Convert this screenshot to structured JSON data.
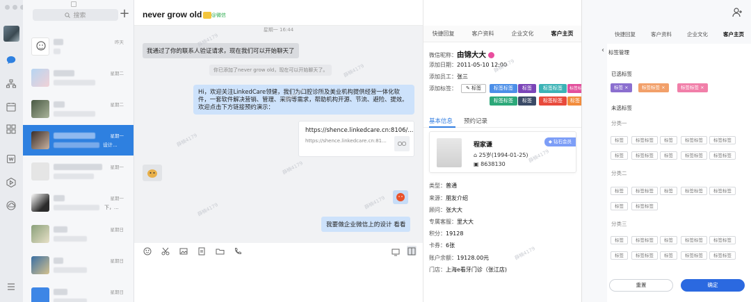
{
  "sidebar": {
    "icons": [
      "chat-icon",
      "contacts-icon",
      "calendar-icon",
      "apps-icon",
      "docs-icon",
      "video-icon",
      "cloud-icon",
      "menu-icon"
    ]
  },
  "chat_list": {
    "search_placeholder": "搜索",
    "items": [
      {
        "time": "昨天",
        "extra": ""
      },
      {
        "time": "星期二",
        "extra": ""
      },
      {
        "time": "星期二",
        "extra": ""
      },
      {
        "time": "星期一",
        "extra": "设计..."
      },
      {
        "time": "星期一",
        "extra": ""
      },
      {
        "time": "星期一",
        "extra": "下，..."
      },
      {
        "time": "星期日",
        "extra": ""
      },
      {
        "time": "星期日",
        "extra": ""
      },
      {
        "time": "星期日",
        "extra": ""
      }
    ]
  },
  "chat": {
    "title": "never grow old",
    "wechat_tag": "@微信",
    "time_divider": "星期一 16:44",
    "msg_verified": "我通过了你的联系人验证请求，现在我们可以开始聊天了",
    "sys_added": "你已添加了never grow old，现在可以开始聊天了。",
    "msg_welcome": "Hi，欢迎关注LinkedCare领健，我们为口腔诊所及美业机构提供经营一体化软件，一套软件解决营销、管理、采购等需求，帮助机构开源、节流、避险、提效。欢迎点击下方链接预约演示：",
    "link_title": "https://shence.linkedcare.cn:8106/...",
    "link_sub": "https://shence.linkedcare.cn:81...",
    "msg_design": "我要做企业微信上的设计  看看",
    "watermark": "薛楠4179"
  },
  "customer": {
    "tabs": [
      "快捷回复",
      "客户资料",
      "企业文化",
      "客户主页"
    ],
    "active_tab": "客户主页",
    "nickname_label": "微信昵称：",
    "nickname": "由锦大大",
    "added_date_label": "添加日期：",
    "added_date": "2011-05-10  12:00",
    "added_staff_label": "添加员工：",
    "added_staff": "张三",
    "tags_label": "添加标签：",
    "add_tag_btn": "标签",
    "tags": [
      {
        "text": "标签标签",
        "color": "#4c8fe8"
      },
      {
        "text": "标签",
        "color": "#7b45b8"
      },
      {
        "text": "标签标签",
        "color": "#3bb3b6"
      },
      {
        "text": "标签标签",
        "color": "#e24f9c"
      },
      {
        "text": "标签标签",
        "color": "#2ca879"
      },
      {
        "text": "标签",
        "color": "#3a4a66"
      },
      {
        "text": "标签标签",
        "color": "#e84a3c"
      },
      {
        "text": "标签",
        "color": "#f28c3c"
      }
    ],
    "subtabs": [
      "基本信息",
      "预约记录"
    ],
    "card": {
      "name": "程家谦",
      "age": "25岁(1994-01-25)",
      "id": "8638130",
      "vip": "钻石会员"
    },
    "info": [
      {
        "label": "类型：",
        "value": "普通"
      },
      {
        "label": "来源：",
        "value": "朋友介绍"
      },
      {
        "label": "顾问：",
        "value": "张大大"
      },
      {
        "label": "专属客服：",
        "value": "里大大"
      },
      {
        "label": "积分：",
        "value": "19128"
      },
      {
        "label": "卡券：",
        "value": "6张"
      },
      {
        "label": "账户余额：",
        "value": "19128.00元"
      },
      {
        "label": "门店：",
        "value": "上海e看牙门诊（张江店)"
      }
    ]
  },
  "tag_manager": {
    "tabs": [
      "快捷回复",
      "客户资料",
      "企业文化",
      "客户主页"
    ],
    "title": "标签管理",
    "selected_label": "已选标签",
    "selected": [
      {
        "text": "标签",
        "color": "#8b6fcf"
      },
      {
        "text": "标签标签",
        "color": "#f2a06a"
      },
      {
        "text": "标签标签",
        "color": "#f17fa9"
      }
    ],
    "unselected_label": "未选标签",
    "groups": [
      {
        "name": "分类一",
        "rows": [
          [
            "标签",
            "标签标签",
            "标签",
            "标签标签",
            "标签标签"
          ],
          [
            "标签",
            "标签标签",
            "标签",
            "标签标签",
            "标签标签"
          ]
        ]
      },
      {
        "name": "分类二",
        "rows": [
          [
            "标签",
            "标签标签",
            "标签",
            "标签标签",
            "标签标签"
          ],
          [
            "标签",
            "标签标签"
          ]
        ]
      },
      {
        "name": "分类三",
        "rows": [
          [
            "标签",
            "标签标签",
            "标签",
            "标签标签",
            "标签标签"
          ],
          [
            "标签",
            "标签标签",
            "标签",
            "标签标签",
            "标签标签"
          ]
        ]
      }
    ],
    "reset": "重置",
    "confirm": "确定"
  }
}
